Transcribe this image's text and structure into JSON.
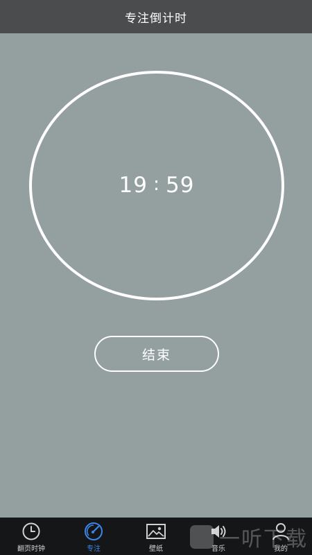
{
  "header": {
    "title": "专注倒计时"
  },
  "timer": {
    "minutes": "19",
    "separator": ":",
    "seconds": "59"
  },
  "actions": {
    "end_label": "结束"
  },
  "tabbar": {
    "items": [
      {
        "label": "翻页时钟",
        "icon": "clock-icon",
        "active": false
      },
      {
        "label": "专注",
        "icon": "focus-dial-icon",
        "active": true
      },
      {
        "label": "壁纸",
        "icon": "picture-icon",
        "active": false
      },
      {
        "label": "音乐",
        "icon": "speaker-icon",
        "active": false
      },
      {
        "label": "我的",
        "icon": "person-icon",
        "active": false
      }
    ]
  },
  "watermark": {
    "text": "一听下载"
  },
  "colors": {
    "background": "#94a09f",
    "header_bg": "#4a4c4e",
    "tabbar_bg": "#151618",
    "accent": "#3b86ea",
    "ring": "#ffffff"
  }
}
